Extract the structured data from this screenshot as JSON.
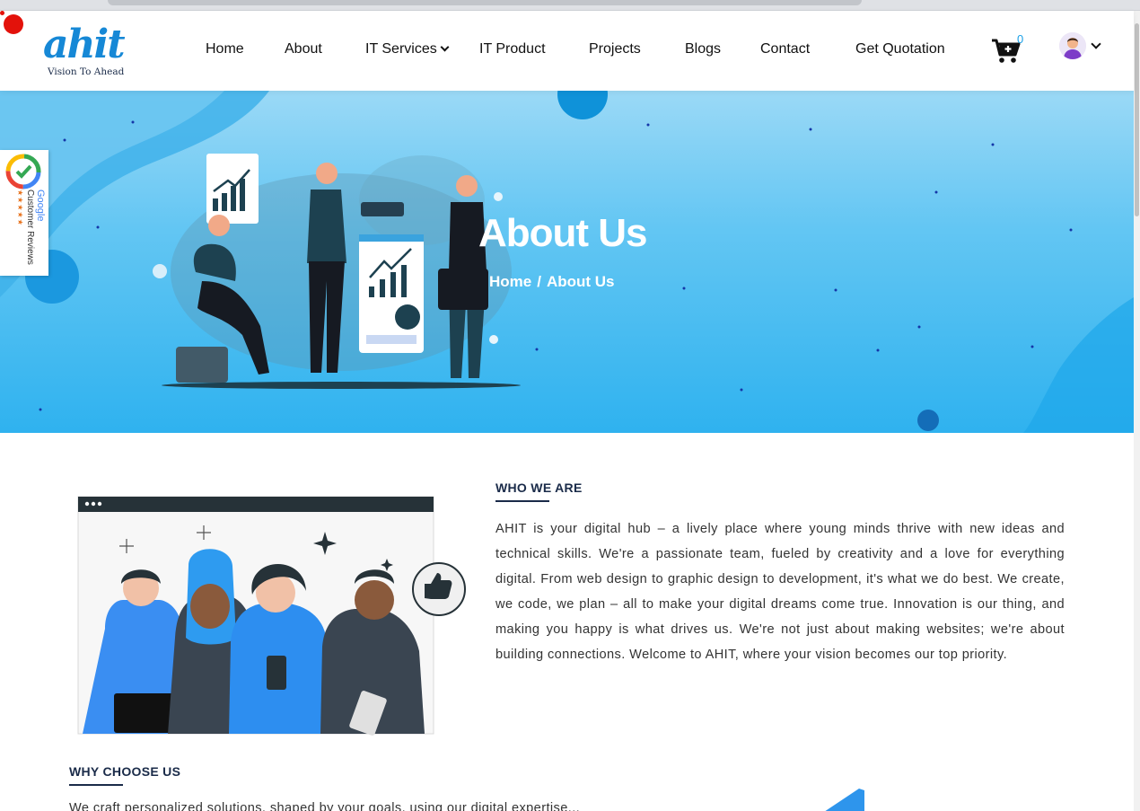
{
  "header": {
    "logo_text": "ahit",
    "logo_tagline": "Vision To Ahead",
    "nav": [
      {
        "label": "Home"
      },
      {
        "label": "About"
      },
      {
        "label": "IT Services"
      },
      {
        "label": "IT Product"
      },
      {
        "label": "Projects"
      },
      {
        "label": "Blogs"
      },
      {
        "label": "Contact"
      },
      {
        "label": "Get Quotation"
      }
    ],
    "cart_count": "0"
  },
  "hero": {
    "title": "About Us",
    "breadcrumb": {
      "home": "Home",
      "separator": "/",
      "current": "About Us"
    }
  },
  "google_badge": {
    "brand": "Google",
    "label": "Customer Reviews",
    "stars": "★★★★★"
  },
  "about": {
    "heading": "WHO WE ARE",
    "body": "AHIT is your digital hub – a lively place where young minds thrive with new ideas and technical skills. We're a passionate team, fueled by creativity and a love for everything digital. From web design to graphic design to development, it's what we do best. We create, we code, we plan – all to make your digital dreams come true. Innovation is our thing, and making you happy is what drives us. We're not just about making websites; we're about building connections. Welcome to AHIT, where your vision becomes our top priority."
  },
  "why": {
    "heading": "WHY CHOOSE US",
    "body": "We craft personalized solutions, shaped by your goals, using our digital expertise..."
  },
  "colors": {
    "accent": "#1ba0e6",
    "heading": "#1a2b49",
    "hero_top": "#9bd9f6",
    "hero_bottom": "#2fb2ef"
  }
}
